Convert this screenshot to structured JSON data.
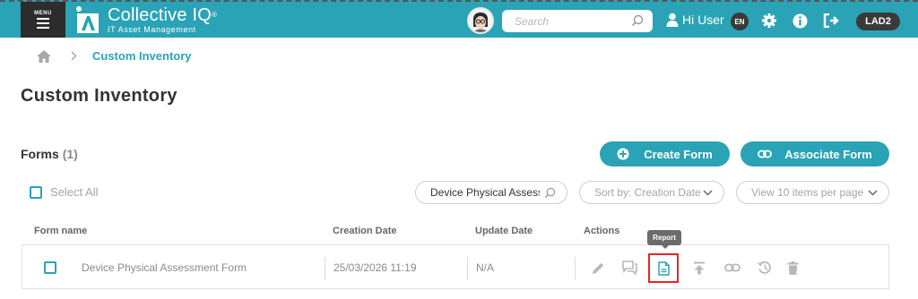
{
  "header": {
    "menu_label": "MENU",
    "brand_name": "Collective IQ",
    "brand_mark": "®",
    "brand_tagline": "IT Asset Management",
    "search_placeholder": "Search",
    "greeting": "Hi User",
    "language": "EN",
    "workspace": "LAD2",
    "accent_color": "#2aa3b6"
  },
  "breadcrumb": {
    "home_icon": "home-icon",
    "current": "Custom Inventory"
  },
  "page": {
    "title": "Custom Inventory"
  },
  "forms": {
    "label": "Forms",
    "count": "(1)",
    "create_label": "Create Form",
    "associate_label": "Associate Form",
    "select_all_label": "Select All",
    "filter_value": "Device Physical Assessment Form",
    "sort_label": "Sort by: Creation Date",
    "view_label": "View 10 items per page"
  },
  "table": {
    "columns": [
      "Form name",
      "Creation Date",
      "Update Date",
      "Actions"
    ],
    "rows": [
      {
        "name": "Device Physical Assessment Form",
        "created": "25/03/2026 11:19",
        "updated": "N/A"
      }
    ],
    "actions": [
      "edit-icon",
      "comments-icon",
      "report-icon",
      "upload-icon",
      "link-icon",
      "history-icon",
      "delete-icon"
    ],
    "tooltip": "Report",
    "highlight_color": "#e3262a"
  }
}
